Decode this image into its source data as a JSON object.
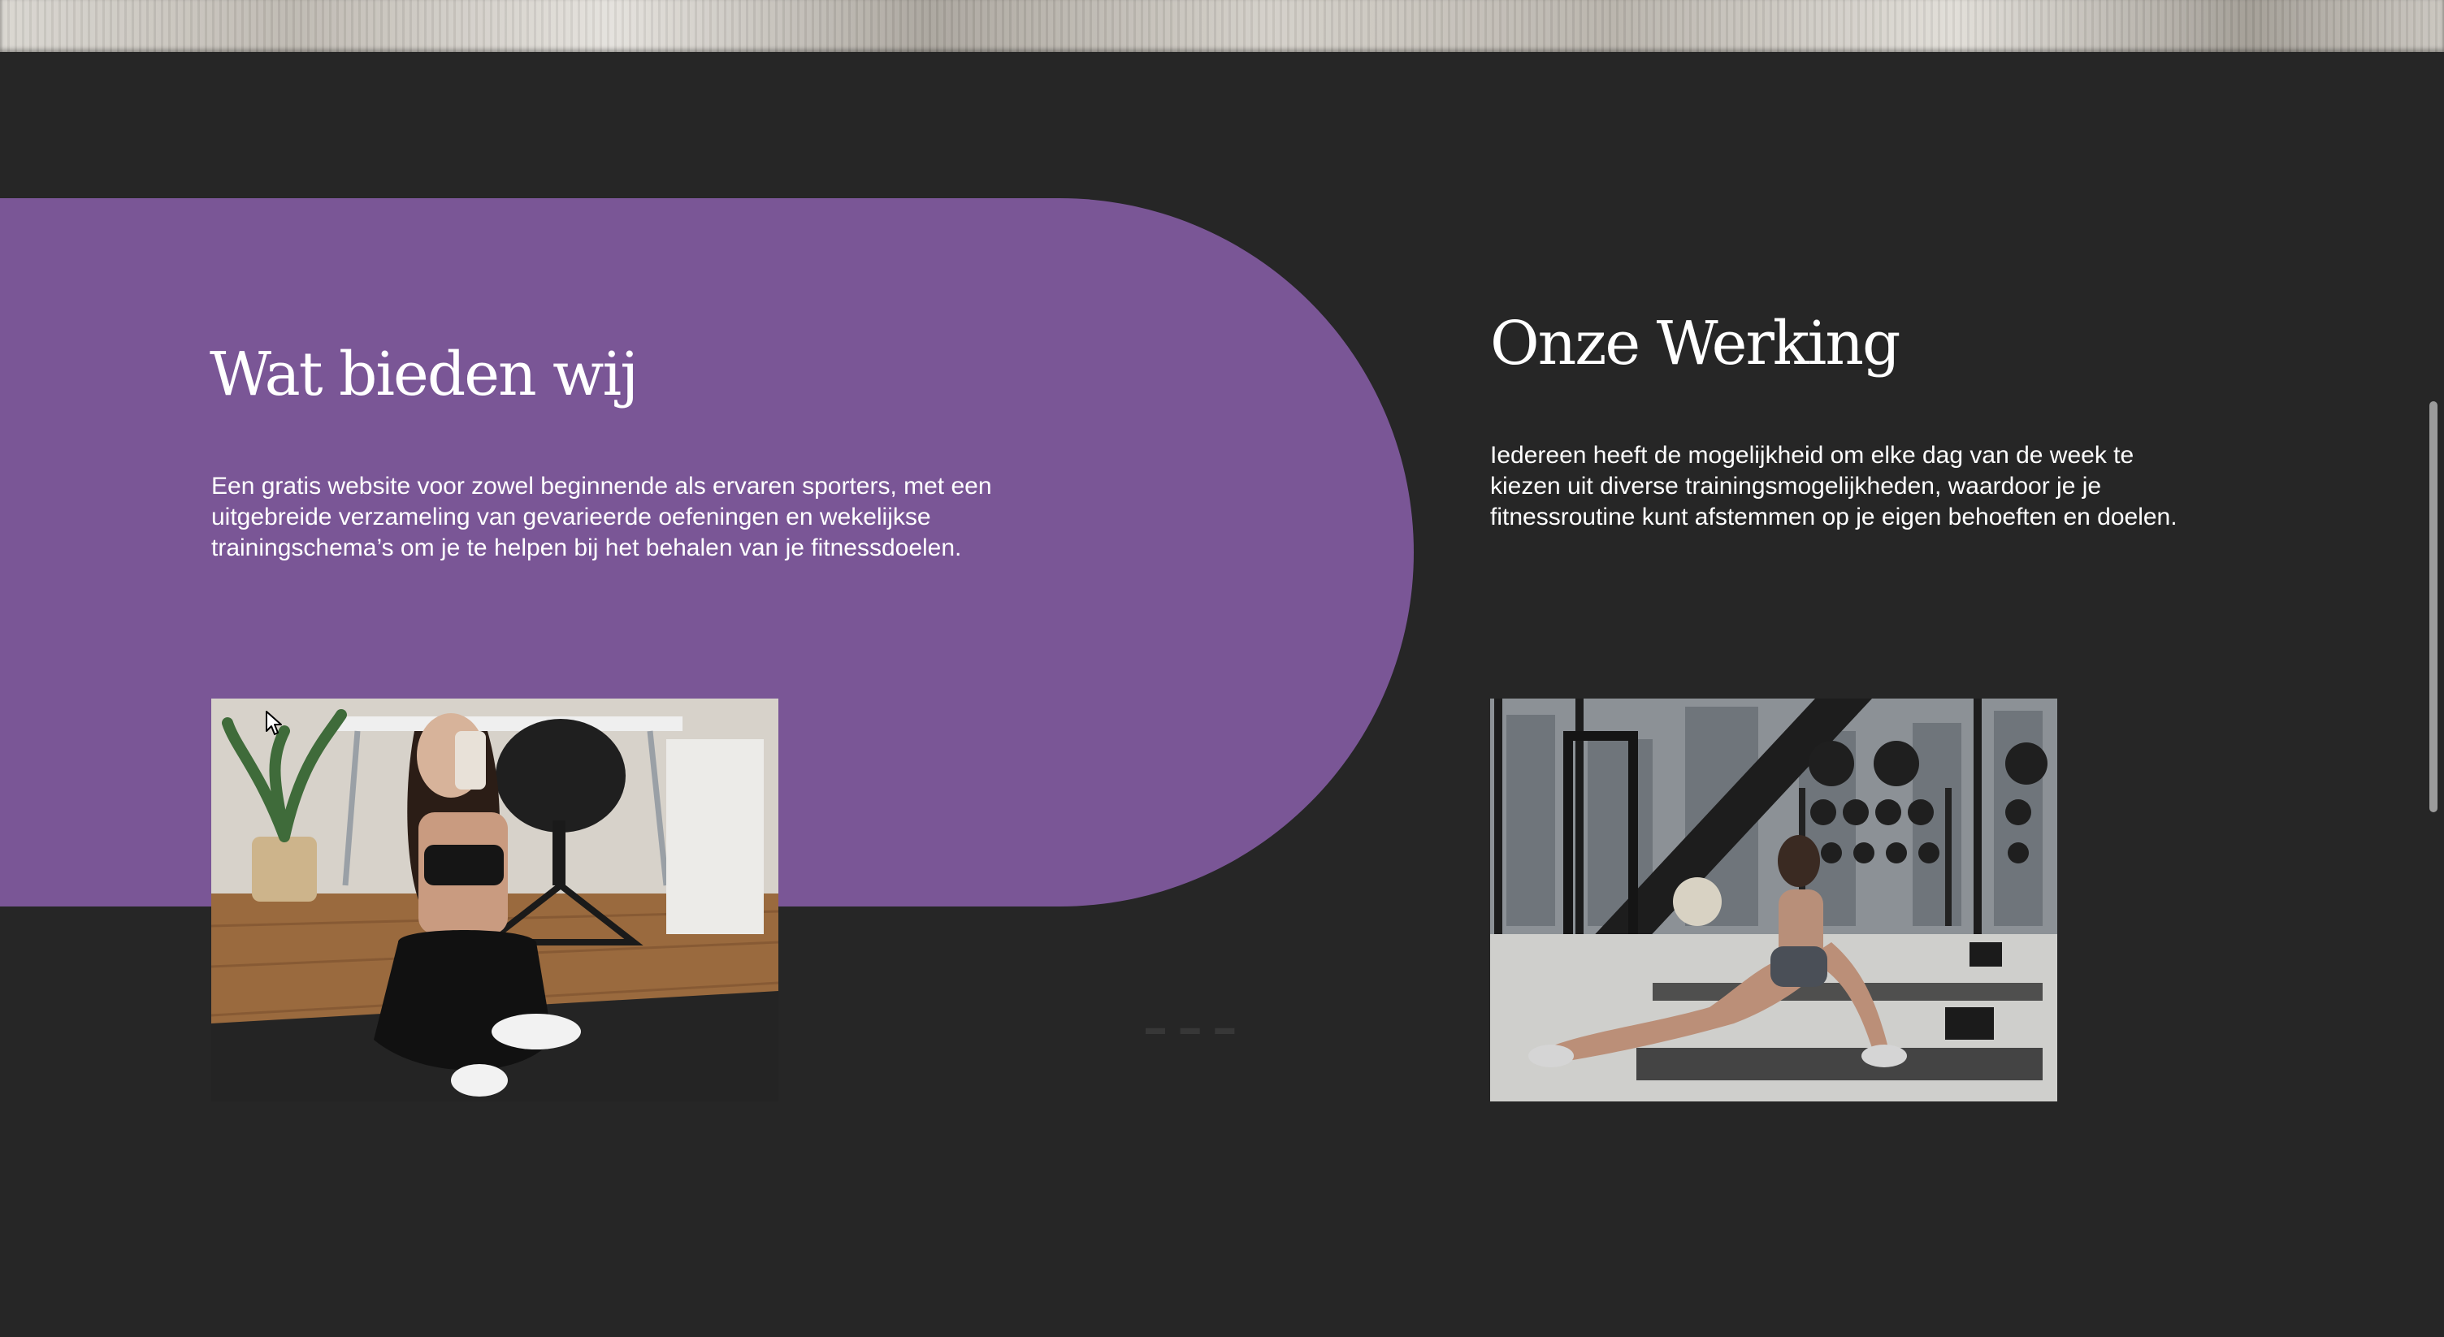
{
  "sections": {
    "offer": {
      "title": "Wat bieden wij",
      "text": "Een gratis website voor zowel beginnende als ervaren sporters, met een uitgebreide verzameling van gevarieerde oefeningen en wekelijkse trainingschema’s om je te helpen bij het behalen van je fitnessdoelen.",
      "image_alt": "Vrouw in sportkleding maakt een spiegelselfie in een woonkamer"
    },
    "working": {
      "title": "Onze Werking",
      "text": "Iedereen heeft de mogelijkheid om elke dag van de week te kiezen uit diverse trainingsmogelijkheden, waardoor je je fitnessroutine kunt afstemmen op je eigen behoeften en doelen.",
      "image_alt": "Vrouw doet een stretchoefening in een fitnessruimte"
    }
  },
  "colors": {
    "background": "#262626",
    "accent_purple": "#7a5696",
    "text": "#ffffff"
  }
}
